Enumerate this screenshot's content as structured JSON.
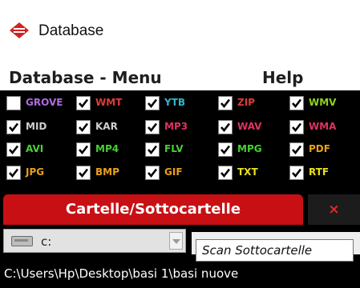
{
  "window": {
    "title": "Database",
    "icon": "database-logo-icon"
  },
  "menu": {
    "database": "Database - Menu",
    "help": "Help"
  },
  "colors": {
    "accent": "#c81014",
    "panel_bg": "#000000",
    "tab_close_x": "#e02a2a"
  },
  "extensions": [
    [
      {
        "label": "GROVE",
        "checked": false,
        "color": "#b06ae0"
      },
      {
        "label": "WMT",
        "checked": true,
        "color": "#e03a3a"
      },
      {
        "label": "YTB",
        "checked": true,
        "color": "#2fb7c8"
      },
      {
        "label": "ZIP",
        "checked": true,
        "color": "#e03a3a"
      },
      {
        "label": "WMV",
        "checked": true,
        "color": "#8fd11f"
      }
    ],
    [
      {
        "label": "MID",
        "checked": true,
        "color": "#d0d0d0"
      },
      {
        "label": "KAR",
        "checked": true,
        "color": "#d0d0d0"
      },
      {
        "label": "MP3",
        "checked": true,
        "color": "#e0325f"
      },
      {
        "label": "WAV",
        "checked": true,
        "color": "#e0325f"
      },
      {
        "label": "WMA",
        "checked": true,
        "color": "#e0325f"
      }
    ],
    [
      {
        "label": "AVI",
        "checked": true,
        "color": "#46d030"
      },
      {
        "label": "MP4",
        "checked": true,
        "color": "#46d030"
      },
      {
        "label": "FLV",
        "checked": true,
        "color": "#46d030"
      },
      {
        "label": "MPG",
        "checked": true,
        "color": "#46d030"
      },
      {
        "label": "PDF",
        "checked": true,
        "color": "#e8a018"
      }
    ],
    [
      {
        "label": "JPG",
        "checked": true,
        "color": "#e8a018"
      },
      {
        "label": "BMP",
        "checked": true,
        "color": "#e8a018"
      },
      {
        "label": "GIF",
        "checked": true,
        "color": "#e8a018"
      },
      {
        "label": "TXT",
        "checked": true,
        "color": "#e8e018"
      },
      {
        "label": "RTF",
        "checked": true,
        "color": "#e8e018"
      }
    ]
  ],
  "tabs": {
    "main": "Cartelle/Sottocartelle",
    "close": "×"
  },
  "drive": {
    "value": "c:",
    "icon": "hard-drive-icon"
  },
  "tooltip": "Scan Sottocartelle",
  "path": "C:\\Users\\Hp\\Desktop\\basi 1\\basi nuove"
}
